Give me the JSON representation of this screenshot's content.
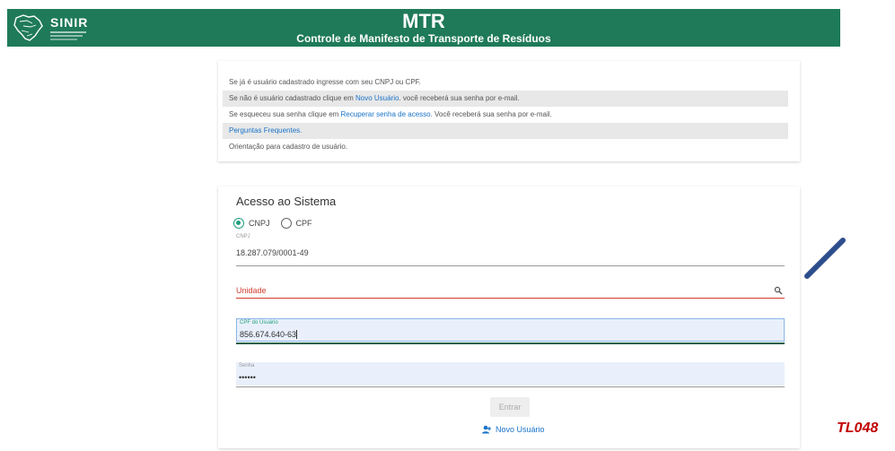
{
  "header": {
    "logo_text": "SINIR",
    "title": "MTR",
    "subtitle": "Controle de Manifesto de Transporte de Resíduos"
  },
  "info": {
    "row1": "Se já é usuário cadastrado ingresse com seu CNPJ ou CPF.",
    "row2_pre": "Se não é usuário cadastrado clique em ",
    "row2_link": "Novo Usuário",
    "row2_post": ". você receberá sua senha por e-mail.",
    "row3_pre": "Se esqueceu sua senha clique em ",
    "row3_link": "Recuperar senha de acesso",
    "row3_post": ". Você receberá sua senha por e-mail.",
    "row4_link": "Perguntas Frequentes.",
    "row5": "Orientação para cadastro de usuário."
  },
  "access": {
    "title": "Acesso ao Sistema",
    "radio_cnpj": "CNPJ",
    "radio_cpf": "CPF",
    "selected": "CNPJ",
    "cnpj_label": "CNPJ",
    "cnpj_value": "18.287.079/0001-49",
    "unidade_label": "Unidade",
    "cpf_label": "CPF do Usuário",
    "cpf_value": "856.674.640-63",
    "senha_label": "Senha",
    "senha_value": "••••••",
    "enter_label": "Entrar",
    "new_user_label": "Novo Usuário"
  },
  "annotation": {
    "tag": "TL048"
  },
  "colors": {
    "header_bg": "#1f7a5a",
    "link": "#1a73c8",
    "error": "#d23f31",
    "accent": "#1f9e7e",
    "pen": "#2e4d8c"
  },
  "icons": [
    "brazil-map-logo-icon",
    "search-icon",
    "user-add-icon",
    "pen-annotation-icon"
  ]
}
